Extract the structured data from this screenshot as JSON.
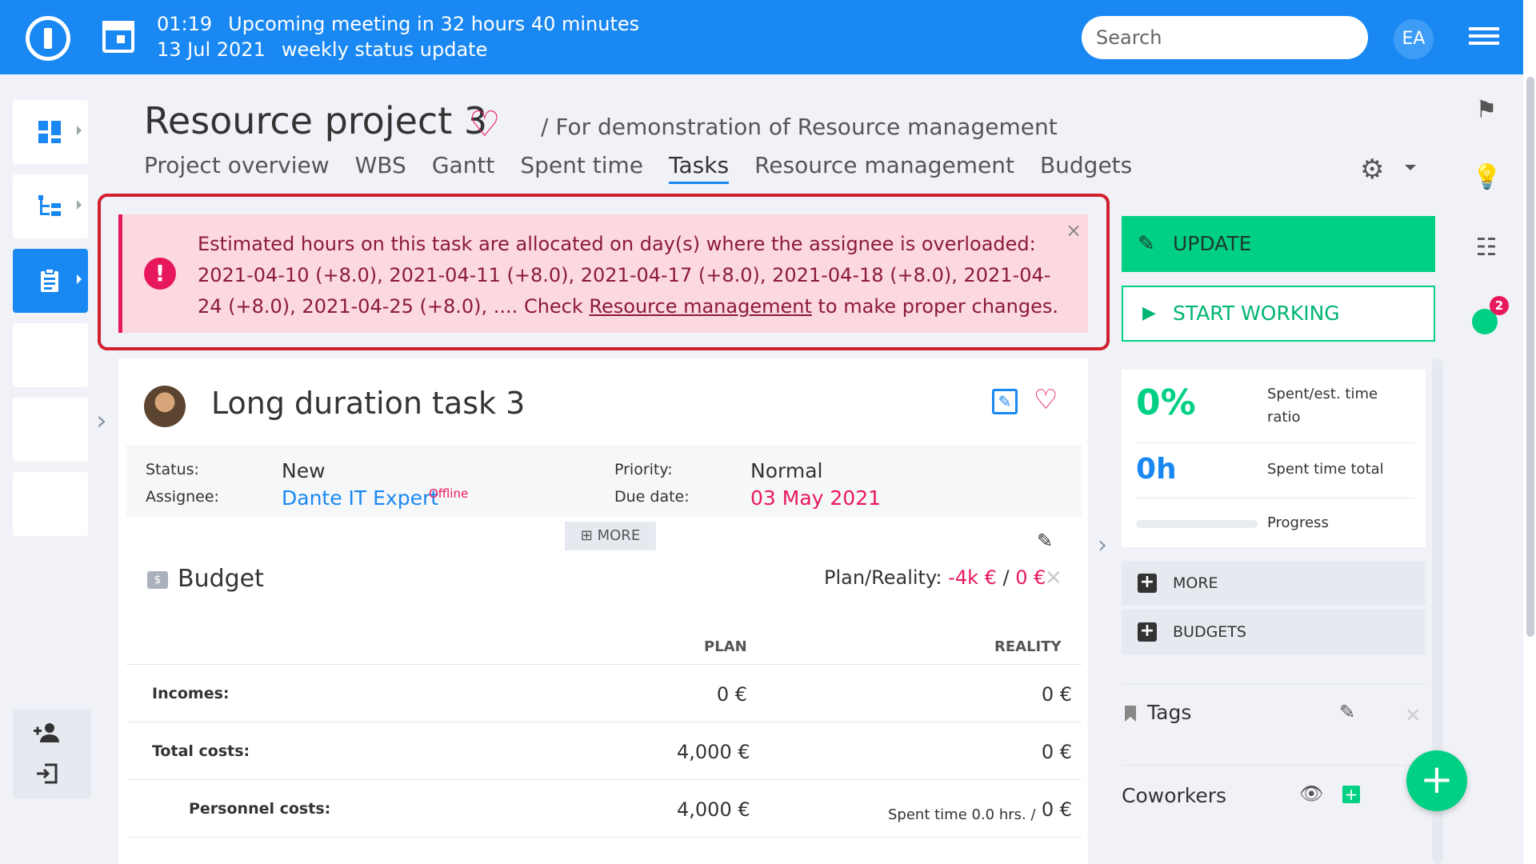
{
  "topbar": {
    "meeting_time": "01:19",
    "meeting_countdown": "Upcoming meeting in 32 hours 40 minutes",
    "meeting_date": "13 Jul 2021",
    "meeting_name": "weekly status update",
    "search_placeholder": "Search",
    "user_initials": "EA",
    "accent_color": "#1a88f2"
  },
  "project": {
    "title": "Resource project 3",
    "subtitle": "/ For demonstration of Resource management",
    "tabs": [
      "Project overview",
      "WBS",
      "Gantt",
      "Spent time",
      "Tasks",
      "Resource management",
      "Budgets"
    ],
    "active_tab": "Tasks"
  },
  "alert": {
    "text_before_link": "Estimated hours on this task are allocated on day(s) where the assignee is overloaded: 2021-04-10 (+8.0), 2021-04-11 (+8.0), 2021-04-17 (+8.0), 2021-04-18 (+8.0), 2021-04-24 (+8.0), 2021-04-25 (+8.0), .... Check ",
    "link_text": "Resource management",
    "text_after_link": " to make proper changes.",
    "close_label": "×"
  },
  "task": {
    "title": "Long duration task 3",
    "attributes": {
      "status_label": "Status:",
      "status_value": "New",
      "assignee_label": "Assignee:",
      "assignee_value": "Dante IT Expert",
      "assignee_presence": "Offline",
      "priority_label": "Priority:",
      "priority_value": "Normal",
      "due_date_label": "Due date:",
      "due_date_value": "03 May 2021"
    },
    "more_label": "MORE"
  },
  "budget": {
    "title": "Budget",
    "plan_reality_label": "Plan/Reality:",
    "plan_value": "-4k €",
    "separator": "/",
    "reality_value": "0 €",
    "columns": [
      "PLAN",
      "REALITY"
    ],
    "rows": [
      {
        "label": "Incomes:",
        "plan": "0 €",
        "reality": "0 €",
        "note": ""
      },
      {
        "label": "Total costs:",
        "plan": "4,000 €",
        "reality": "0 €",
        "note": ""
      },
      {
        "label": "Personnel costs:",
        "plan": "4,000 €",
        "reality": "0 €",
        "note": "Spent time 0.0 hrs. /"
      }
    ]
  },
  "sidebar_right": {
    "update_label": "UPDATE",
    "start_working_label": "START WORKING",
    "spent_ratio_value": "0%",
    "spent_ratio_label": "Spent/est. time ratio",
    "spent_total_value": "0h",
    "spent_total_label": "Spent time total",
    "progress_label": "Progress",
    "progress_fraction": 0,
    "more_label": "MORE",
    "budgets_label": "BUDGETS",
    "tags_label": "Tags",
    "coworkers_label": "Coworkers",
    "timer_badge": "2"
  }
}
